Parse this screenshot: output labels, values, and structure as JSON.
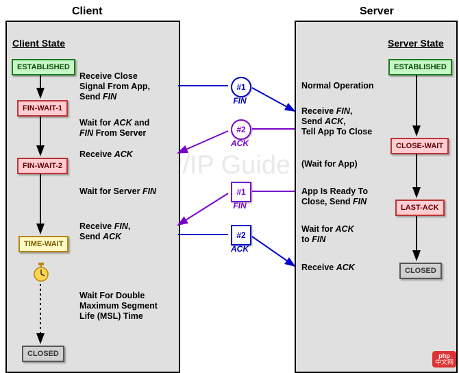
{
  "titles": {
    "client": "Client",
    "server": "Server"
  },
  "headers": {
    "client_state": "Client State",
    "server_state": "Server State"
  },
  "client_states": {
    "established": "ESTABLISHED",
    "fin_wait_1": "FIN-WAIT-1",
    "fin_wait_2": "FIN-WAIT-2",
    "time_wait": "TIME-WAIT",
    "closed": "CLOSED"
  },
  "server_states": {
    "established": "ESTABLISHED",
    "close_wait": "CLOSE-WAIT",
    "last_ack": "LAST-ACK",
    "closed": "CLOSED"
  },
  "client_events": {
    "e1a": "Receive Close",
    "e1b": "Signal From App,",
    "e1c": "Send <i>FIN</i>",
    "e2a": "Wait for <i>ACK</i> and",
    "e2b": "<i>FIN</i> From Server",
    "e3": "Receive <i>ACK</i>",
    "e4": "Wait for Server <i>FIN</i>",
    "e5a": "Receive <i>FIN</i>,",
    "e5b": "Send <i>ACK</i>",
    "e6a": "Wait For Double",
    "e6b": "Maximum Segment",
    "e6c": "Life (MSL) Time"
  },
  "server_events": {
    "s1": "Normal Operation",
    "s2a": "Receive <i>FIN</i>,",
    "s2b": "Send <i>ACK</i>,",
    "s2c": "Tell App To Close",
    "s3": "(Wait for App)",
    "s4a": "App Is Ready To",
    "s4b": "Close, Send <i>FIN</i>",
    "s5a": "Wait for <i>ACK</i>",
    "s5b": "to <i>FIN</i>",
    "s6": "Receive <i>ACK</i>"
  },
  "messages": {
    "m1": "#1",
    "m1_label": "FIN",
    "m2": "#2",
    "m2_label": "ACK",
    "m3": "#1",
    "m3_label": "FIN",
    "m4": "#2",
    "m4_label": "ACK"
  },
  "watermark": "The TCP/IP Guide",
  "logo_top": "php",
  "logo_bot": "中文网"
}
